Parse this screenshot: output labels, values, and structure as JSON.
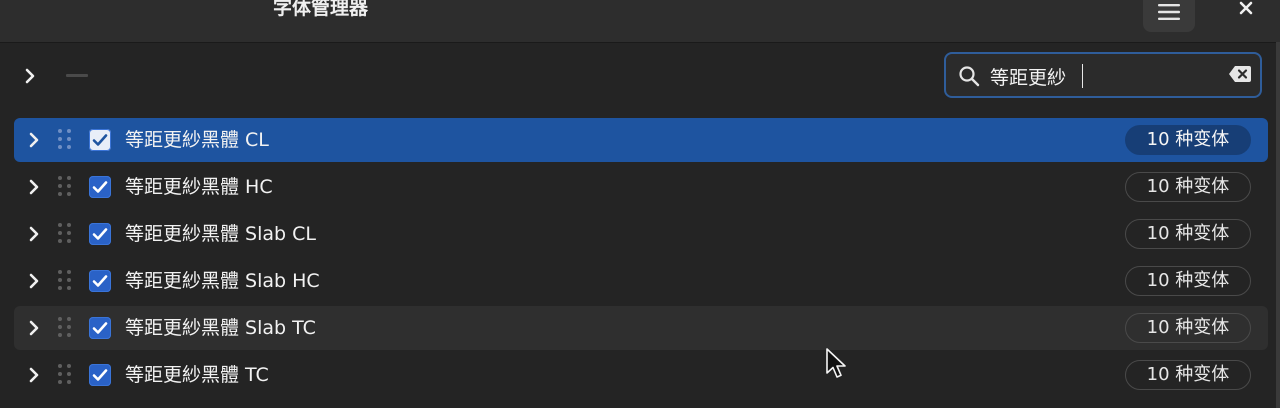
{
  "window": {
    "title": "字体管理器",
    "menu_icon": "hamburger-menu-icon",
    "close_icon": "close-icon"
  },
  "toolbar": {
    "expand_icon": "chevron-right-icon",
    "remove_icon": "minus-icon"
  },
  "search": {
    "value": "等距更紗",
    "placeholder": "",
    "icon": "search-icon",
    "clear_icon": "backspace-clear-icon"
  },
  "fonts": [
    {
      "name": "等距更紗黑體  CL",
      "variants": "10 种变体",
      "checked": true,
      "state": "selected"
    },
    {
      "name": "等距更紗黑體  HC",
      "variants": "10 种变体",
      "checked": true,
      "state": "normal"
    },
    {
      "name": "等距更紗黑體  Slab CL",
      "variants": "10 种变体",
      "checked": true,
      "state": "normal"
    },
    {
      "name": "等距更紗黑體  Slab HC",
      "variants": "10 种变体",
      "checked": true,
      "state": "normal"
    },
    {
      "name": "等距更紗黑體  Slab TC",
      "variants": "10 种变体",
      "checked": true,
      "state": "hover"
    },
    {
      "name": "等距更紗黑體  TC",
      "variants": "10 种变体",
      "checked": true,
      "state": "normal"
    }
  ],
  "colors": {
    "background": "#242424",
    "headerbar": "#2d2d2d",
    "accent": "#1e54a0",
    "checkbox": "#2a62c7",
    "search_border": "#2f5d9a"
  }
}
